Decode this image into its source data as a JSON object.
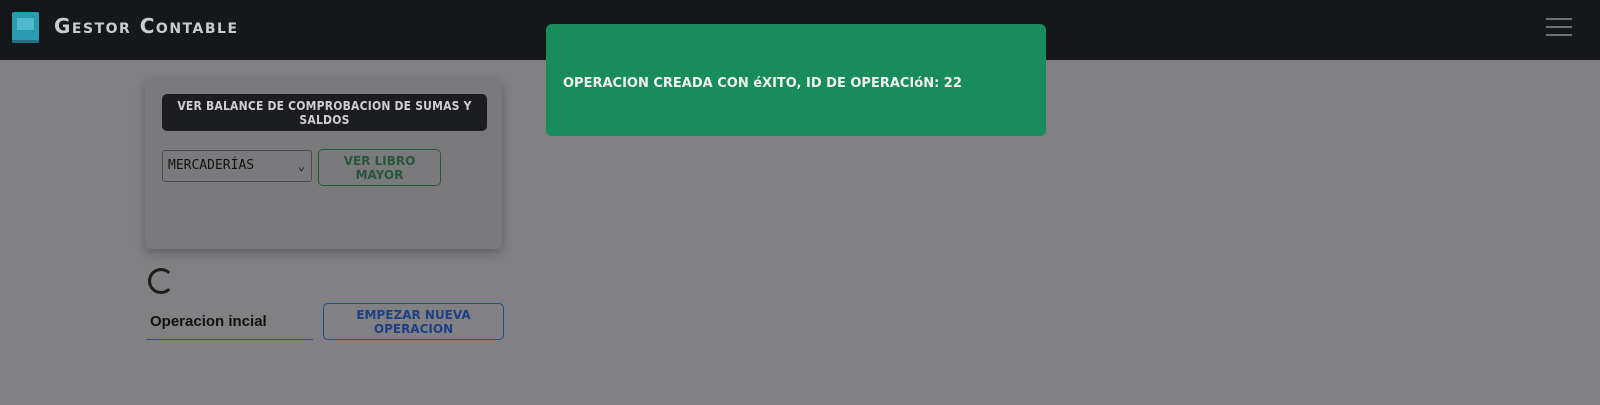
{
  "navbar": {
    "brand_name": "Gestor Contable",
    "brand_icon": "book-icon",
    "menu_icon": "hamburger-icon"
  },
  "accounts_card": {
    "balance_button_label": "VER BALANCE DE COMPROBACION DE SUMAS Y SALDOS",
    "account_select_value": "MERCADERÍAS",
    "ledger_button_label": "VER LIBRO MAYOR"
  },
  "operation": {
    "loading_icon": "spinner-icon",
    "input_value": "Operacion incial",
    "new_operation_button_label": "EMPEZAR NUEVA OPERACION"
  },
  "toast": {
    "message": "OPERACION CREADA CON éXITO, ID DE OPERACIóN: 22"
  },
  "colors": {
    "navbar_bg": "#16171b",
    "toast_bg": "#198c5b",
    "overlay_bg": "#818083"
  }
}
